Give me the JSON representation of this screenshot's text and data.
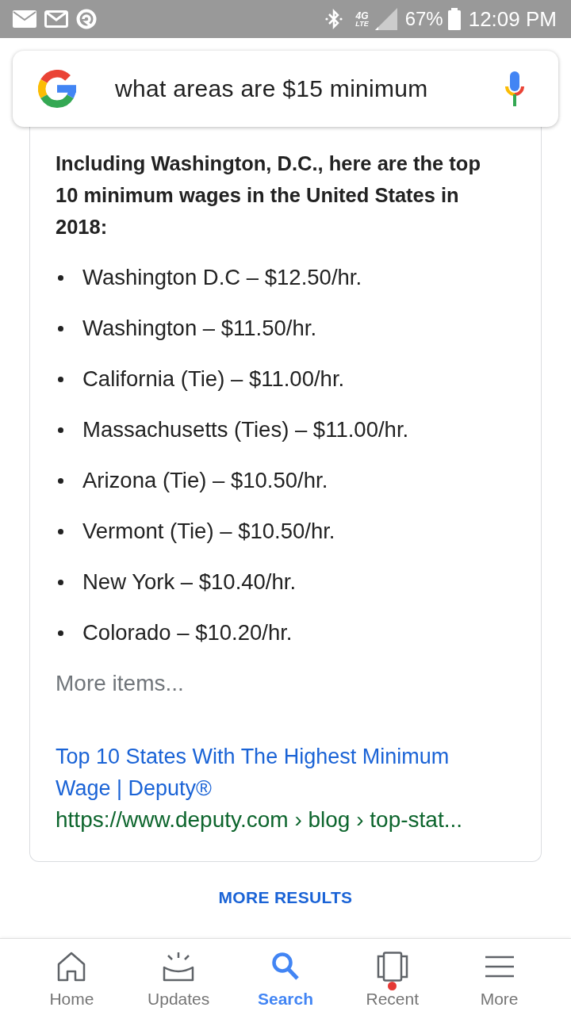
{
  "status_bar": {
    "network": "4G",
    "network_sub": "LTE",
    "battery": "67%",
    "time": "12:09 PM"
  },
  "search": {
    "query": "what areas are $15 minimum"
  },
  "answer": {
    "heading": "Including Washington, D.C., here are the top 10 minimum wages in the United States in 2018:",
    "items": [
      "Washington D.C – $12.50/hr.",
      "Washington – $11.50/hr.",
      "California (Tie) – $11.00/hr.",
      "Massachusetts (Ties) – $11.00/hr.",
      "Arizona (Tie) – $10.50/hr.",
      "Vermont (Tie) – $10.50/hr.",
      "New York – $10.40/hr.",
      "Colorado – $10.20/hr."
    ],
    "more": "More items...",
    "source": {
      "title": "Top 10 States With The Highest Minimum Wage | Deputy®",
      "url": "https://www.deputy.com › blog › top-stat..."
    }
  },
  "more_results": "MORE RESULTS",
  "bottom_nav": [
    {
      "kind": "home",
      "label": "Home",
      "selected": false,
      "notification": false
    },
    {
      "kind": "updates",
      "label": "Updates",
      "selected": false,
      "notification": false
    },
    {
      "kind": "search",
      "label": "Search",
      "selected": true,
      "notification": false
    },
    {
      "kind": "recent",
      "label": "Recent",
      "selected": false,
      "notification": true
    },
    {
      "kind": "more",
      "label": "More",
      "selected": false,
      "notification": false
    }
  ]
}
